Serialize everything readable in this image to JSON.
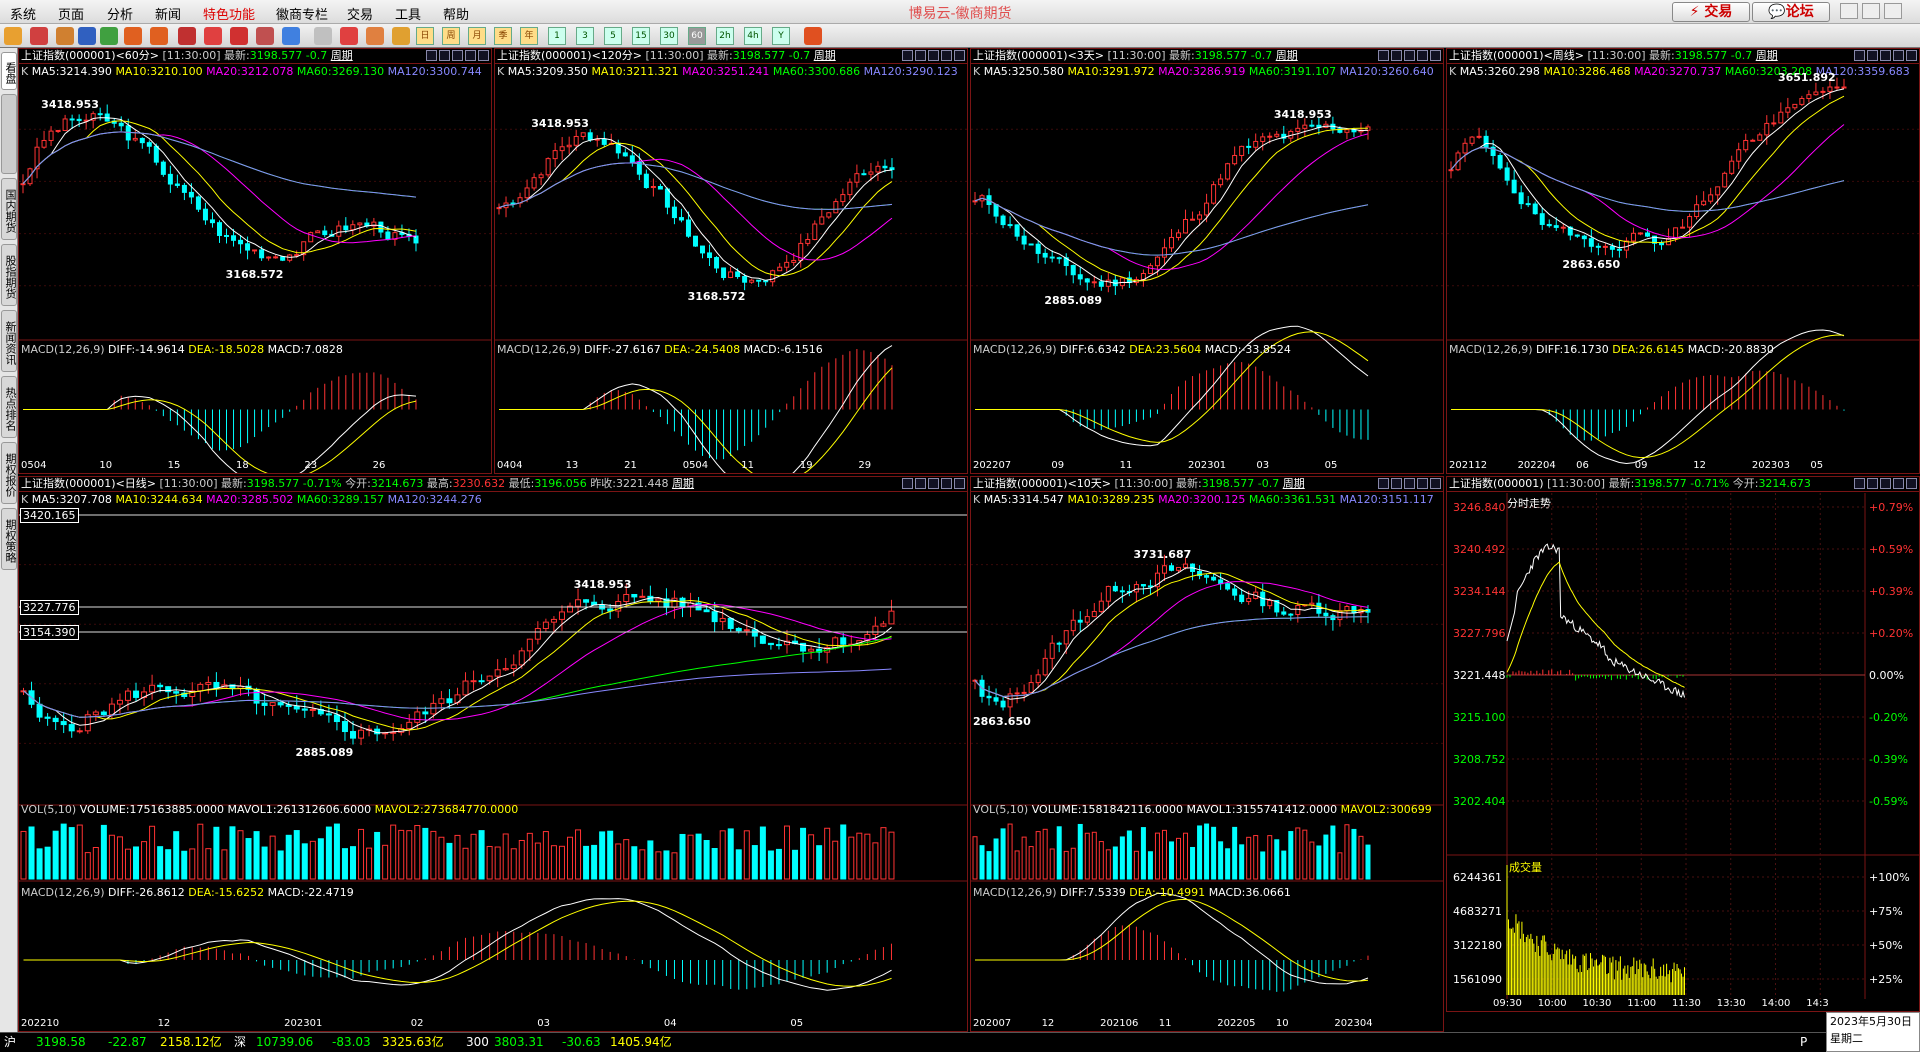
{
  "app": {
    "title": "博易云-徽商期货",
    "trade_label": "交易",
    "forum_label": "论坛"
  },
  "menu": [
    "系统",
    "页面",
    "分析",
    "新闻",
    "特色功能",
    "徽商专栏",
    "交易",
    "工具",
    "帮助"
  ],
  "sidebar": [
    "看盘",
    "国内期货",
    "股指期货",
    "新闻资讯",
    "热点排名",
    "期权报价",
    "期权策略"
  ],
  "toolbar_periods": [
    "日",
    "周",
    "月",
    "季",
    "年",
    "1",
    "3",
    "5",
    "15",
    "30",
    "60",
    "2h",
    "4h",
    "Y"
  ],
  "panels": {
    "p60": {
      "name": "上证指数",
      "code": "(000001)<60分>",
      "time": "[11:30:00]",
      "latest_label": "最新:",
      "latest": "3198.577",
      "chg": "-0.7",
      "period": "周期",
      "ma": {
        "ma5": "MA5:3214.390",
        "ma10": "MA10:3210.100",
        "ma20": "MA20:3212.078",
        "ma60": "MA60:3269.130",
        "ma120": "MA120:3300.744"
      },
      "macd": {
        "label": "MACD(12,26,9)",
        "diff": "DIFF:-14.9614",
        "dea": "DEA:-18.5028",
        "macd": "MACD:7.0828"
      },
      "high": "3418.953",
      "low": "3168.572",
      "xticks": [
        "0504",
        "10",
        "15",
        "18",
        "23",
        "26"
      ]
    },
    "p120": {
      "name": "上证指数",
      "code": "(000001)<120分>",
      "time": "[11:30:00]",
      "latest_label": "最新:",
      "latest": "3198.577",
      "chg": "-0.7",
      "period": "周期",
      "ma": {
        "ma5": "MA5:3209.350",
        "ma10": "MA10:3211.321",
        "ma20": "MA20:3251.241",
        "ma60": "MA60:3300.686",
        "ma120": "MA120:3290.123"
      },
      "macd": {
        "label": "MACD(12,26,9)",
        "diff": "DIFF:-27.6167",
        "dea": "DEA:-24.5408",
        "macd": "MACD:-6.1516"
      },
      "high": "3418.953",
      "low": "3168.572",
      "xticks": [
        "0404",
        "13",
        "21",
        "0504",
        "11",
        "19",
        "29"
      ]
    },
    "p3d": {
      "name": "上证指数",
      "code": "(000001)<3天>",
      "time": "[11:30:00]",
      "latest_label": "最新:",
      "latest": "3198.577",
      "chg": "-0.7",
      "period": "周期",
      "ma": {
        "ma5": "MA5:3250.580",
        "ma10": "MA10:3291.972",
        "ma20": "MA20:3286.919",
        "ma60": "MA60:3191.107",
        "ma120": "MA120:3260.640"
      },
      "macd": {
        "label": "MACD(12,26,9)",
        "diff": "DIFF:6.6342",
        "dea": "DEA:23.5604",
        "macd": "MACD:-33.8524"
      },
      "high": "3418.953",
      "low": "2885.089",
      "xticks": [
        "202207",
        "09",
        "11",
        "202301",
        "03",
        "05"
      ]
    },
    "pweek": {
      "name": "上证指数",
      "code": "(000001)<周线>",
      "time": "[11:30:00]",
      "latest_label": "最新:",
      "latest": "3198.577",
      "chg": "-0.7",
      "period": "周期",
      "ma": {
        "ma5": "MA5:3260.298",
        "ma10": "MA10:3286.468",
        "ma20": "MA20:3270.737",
        "ma60": "MA60:3203.208",
        "ma120": "MA120:3359.683"
      },
      "macd": {
        "label": "MACD(12,26,9)",
        "diff": "DIFF:16.1730",
        "dea": "DEA:26.6145",
        "macd": "MACD:-20.8830"
      },
      "high": "3651.892",
      "low": "2863.650",
      "xticks": [
        "202112",
        "202204",
        "06",
        "09",
        "12",
        "202303",
        "05"
      ]
    },
    "pday": {
      "name": "上证指数",
      "code": "(000001)<日线>",
      "time": "[11:30:00]",
      "latest_label": "最新:",
      "latest": "3198.577",
      "chg": "-0.71%",
      "open_label": "今开:",
      "open": "3214.673",
      "hi_label": "最高:",
      "hi": "3230.632",
      "lo_label": "最低:",
      "lo": "3196.056",
      "prev_label": "昨收:",
      "prev": "3221.448",
      "period": "周期",
      "ma": {
        "ma5": "MA5:3207.708",
        "ma10": "MA10:3244.634",
        "ma20": "MA20:3285.502",
        "ma60": "MA60:3289.157",
        "ma120": "MA120:3244.276"
      },
      "vol": {
        "label": "VOL(5,10)",
        "volume": "VOLUME:175163885.0000",
        "mavol1": "MAVOL1:261312606.6000",
        "mavol2": "MAVOL2:273684770.0000"
      },
      "macd": {
        "label": "MACD(12,26,9)",
        "diff": "DIFF:-26.8612",
        "dea": "DEA:-15.6252",
        "macd": "MACD:-22.4719"
      },
      "high": "3418.953",
      "low": "2885.089",
      "lines": [
        "3420.165",
        "3227.776",
        "3154.390"
      ],
      "xticks": [
        "202210",
        "12",
        "202301",
        "02",
        "03",
        "04",
        "05"
      ]
    },
    "p10d": {
      "name": "上证指数",
      "code": "(000001)<10天>",
      "time": "[11:30:00]",
      "latest_label": "最新:",
      "latest": "3198.577",
      "chg": "-0.7",
      "period": "周期",
      "ma": {
        "ma5": "MA5:3314.547",
        "ma10": "MA10:3289.235",
        "ma20": "MA20:3200.125",
        "ma60": "MA60:3361.531",
        "ma120": "MA120:3151.117"
      },
      "vol": {
        "label": "VOL(5,10)",
        "volume": "VOLUME:1581842116.0000",
        "mavol1": "MAVOL1:3155741412.0000",
        "mavol2": "MAVOL2:300699"
      },
      "macd": {
        "label": "MACD(12,26,9)",
        "diff": "DIFF:7.5339",
        "dea": "DEA:-10.4991",
        "macd": "MACD:36.0661"
      },
      "high": "3731.687",
      "low": "2863.650",
      "xticks": [
        "202007",
        "12",
        "202106",
        "11",
        "202205",
        "10",
        "202304"
      ]
    },
    "pintra": {
      "name": "上证指数",
      "code": "(000001)",
      "time": "[11:30:00]",
      "latest_label": "最新:",
      "latest": "3198.577",
      "chg": "-0.71%",
      "open_label": "今开:",
      "open": "3214.673",
      "sub": "分时走势",
      "vol_label": "成交量",
      "prices": [
        "3246.840",
        "3240.492",
        "3234.144",
        "3227.796",
        "3221.448",
        "3215.100",
        "3208.752",
        "3202.404"
      ],
      "pcts": [
        "+0.79%",
        "+0.59%",
        "+0.39%",
        "+0.20%",
        "0.00%",
        "-0.20%",
        "-0.39%",
        "-0.59%"
      ],
      "vols": [
        "6244361",
        "4683271",
        "3122180",
        "1561090"
      ],
      "vpcts": [
        "+100%",
        "+75%",
        "+50%",
        "+25%"
      ],
      "xticks": [
        "09:30",
        "10:00",
        "10:30",
        "11:00",
        "11:30",
        "13:30",
        "14:00",
        "14:3"
      ]
    }
  },
  "status": {
    "sh": "沪",
    "sh_val": "3198.58",
    "sh_chg": "-22.87",
    "sh_amt": "2158.12亿",
    "sz": "深",
    "sz_val": "10739.06",
    "sz_chg": "-83.03",
    "sz_amt": "3325.63亿",
    "s300": "300",
    "s300_val": "3803.31",
    "s300_chg": "-30.63",
    "s300_amt": "1405.94亿",
    "date": "2023年5月30日",
    "weekday": "星期二",
    "pg": "P"
  }
}
